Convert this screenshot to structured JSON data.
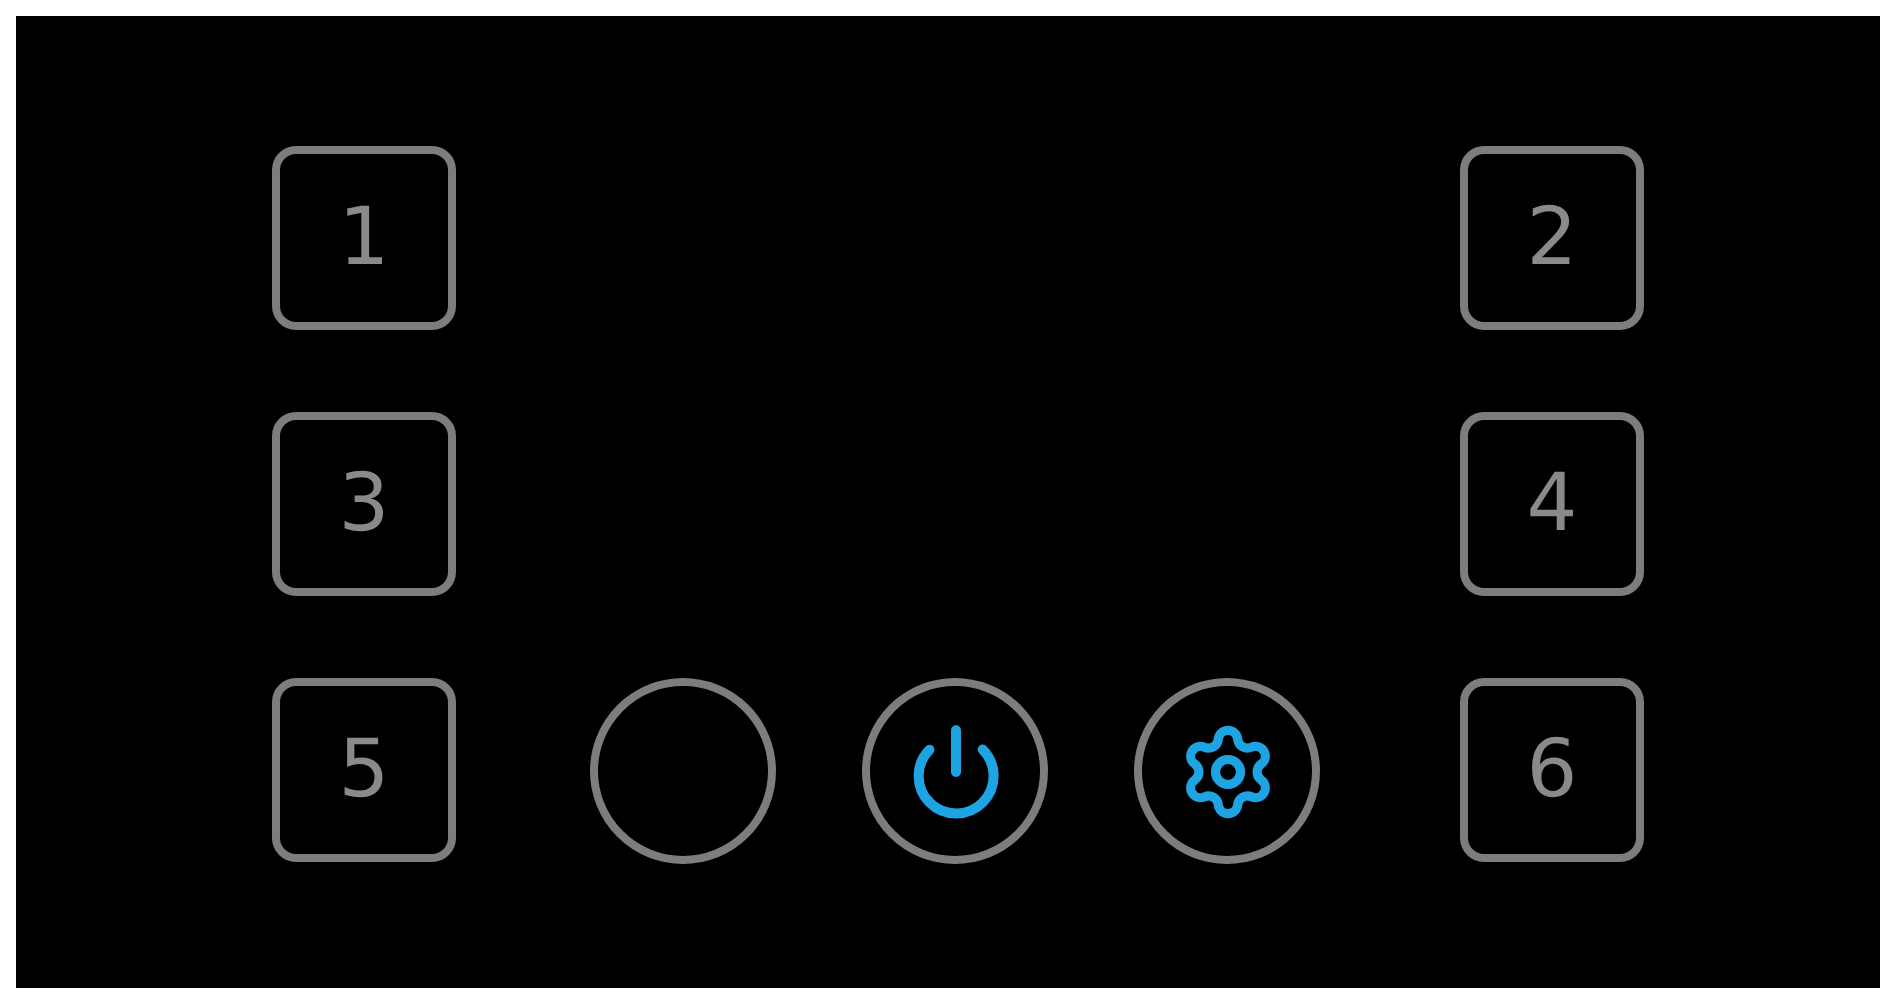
{
  "keys": [
    {
      "label": "1"
    },
    {
      "label": "2"
    },
    {
      "label": "3"
    },
    {
      "label": "4"
    },
    {
      "label": "5"
    },
    {
      "label": "6"
    }
  ],
  "round_buttons": [
    {
      "kind": "blank"
    },
    {
      "kind": "power"
    },
    {
      "kind": "settings"
    }
  ]
}
